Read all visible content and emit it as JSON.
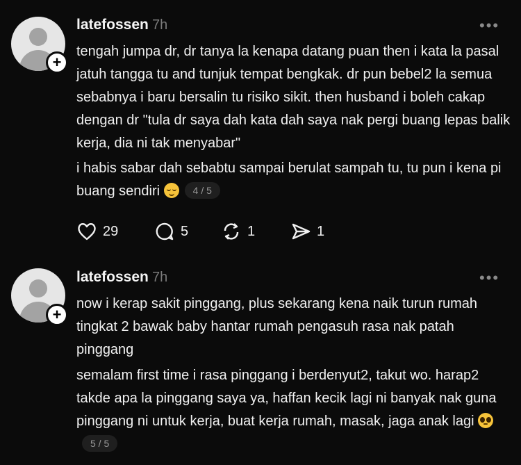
{
  "posts": [
    {
      "username": "latefossen",
      "time": "7h",
      "more": "•••",
      "paragraph1": "tengah jumpa dr, dr tanya la kenapa datang puan then i kata la pasal jatuh tangga tu and tunjuk tempat bengkak. dr pun bebel2 la semua sebabnya i baru bersalin tu risiko sikit. then husband i boleh cakap dengan dr \"tula dr saya dah kata dah saya nak pergi buang lepas balik kerja, dia ni tak menyabar\"",
      "paragraph2": "i habis sabar dah sebabtu sampai berulat sampah tu, tu pun i kena pi buang sendiri",
      "emoji": "relieved-face",
      "pager": "4 / 5",
      "likes": "29",
      "comments": "5",
      "reposts": "1",
      "shares": "1"
    },
    {
      "username": "latefossen",
      "time": "7h",
      "more": "•••",
      "paragraph1": "now i kerap sakit pinggang, plus sekarang kena naik turun rumah tingkat 2 bawak baby hantar rumah pengasuh rasa nak patah pinggang",
      "paragraph2": "semalam first time i rasa pinggang i berdenyut2, takut wo. harap2 takde apa la pinggang saya ya, haffan kecik lagi ni banyak nak guna pinggang ni untuk kerja, buat kerja rumah, masak, jaga anak lagi",
      "emoji": "pleading-face",
      "pager": "5 / 5"
    }
  ]
}
